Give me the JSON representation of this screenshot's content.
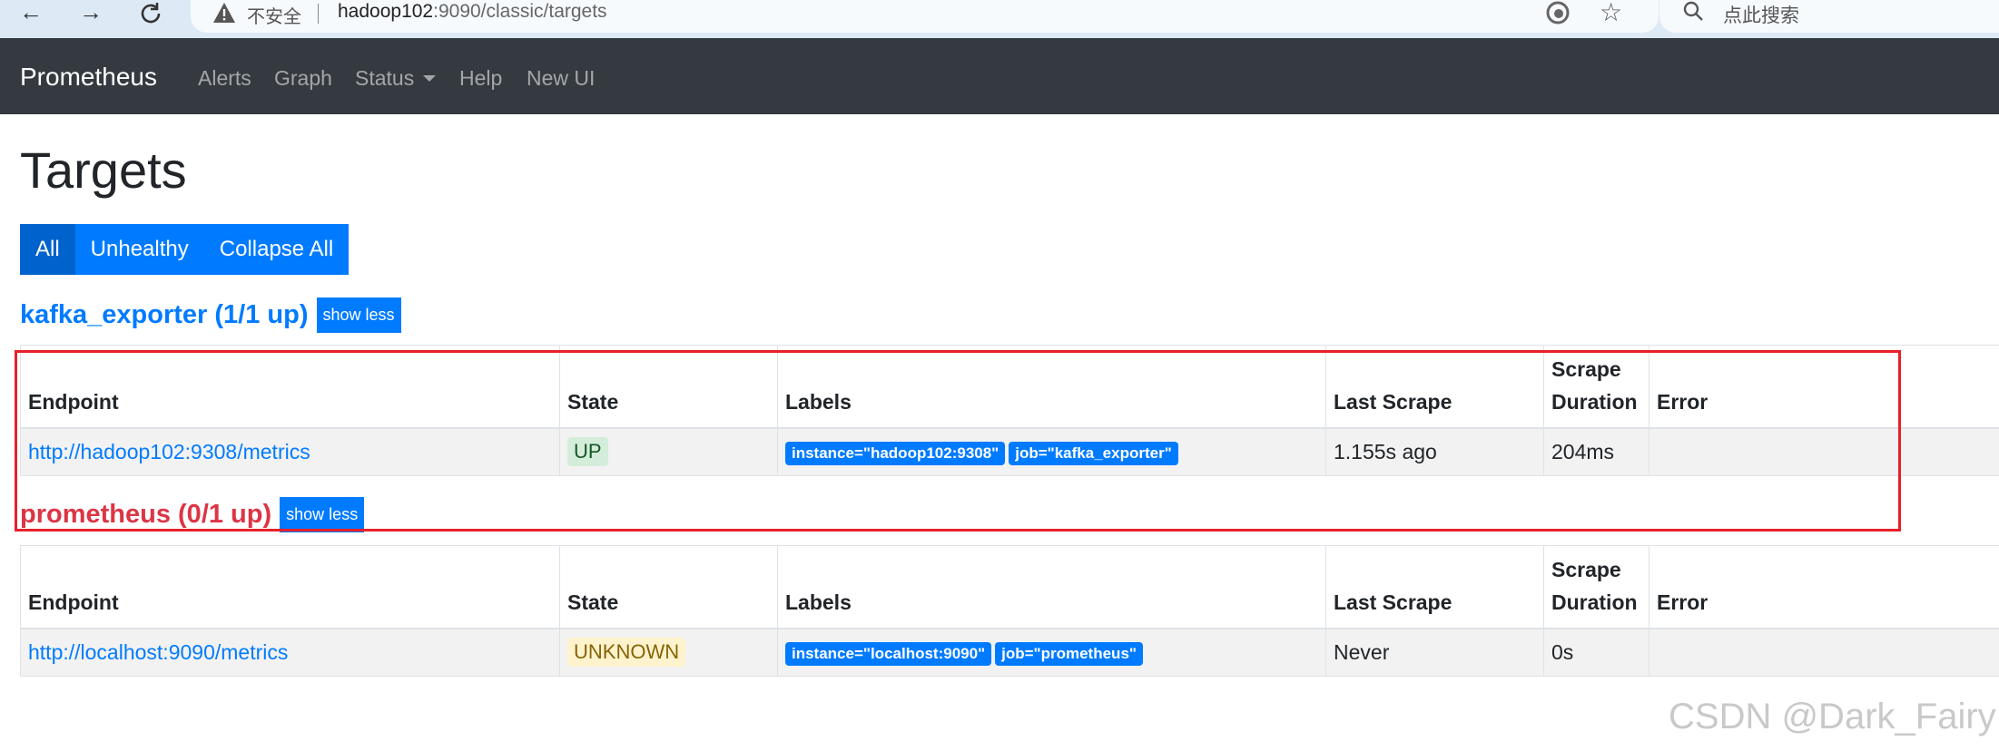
{
  "browser": {
    "insecure_label": "不安全",
    "url_host": "hadoop102",
    "url_rest": ":9090/classic/targets",
    "search_placeholder": "点此搜索"
  },
  "navbar": {
    "brand": "Prometheus",
    "links": [
      "Alerts",
      "Graph",
      "Status",
      "Help",
      "New UI"
    ]
  },
  "page": {
    "title": "Targets",
    "filters": [
      "All",
      "Unhealthy",
      "Collapse All"
    ]
  },
  "columns": [
    "Endpoint",
    "State",
    "Labels",
    "Last Scrape",
    "Scrape Duration",
    "Error"
  ],
  "jobs": [
    {
      "header": "kafka_exporter (1/1 up)",
      "toggle": "show less",
      "targets": [
        {
          "endpoint": "http://hadoop102:9308/metrics",
          "state": "UP",
          "labels": [
            "instance=\"hadoop102:9308\"",
            "job=\"kafka_exporter\""
          ],
          "last_scrape": "1.155s ago",
          "duration": "204ms",
          "error": ""
        }
      ]
    },
    {
      "header": "prometheus (0/1 up)",
      "toggle": "show less",
      "targets": [
        {
          "endpoint": "http://localhost:9090/metrics",
          "state": "UNKNOWN",
          "labels": [
            "instance=\"localhost:9090\"",
            "job=\"prometheus\""
          ],
          "last_scrape": "Never",
          "duration": "0s",
          "error": ""
        }
      ]
    }
  ],
  "watermark": "CSDN @Dark_Fairy",
  "colors": {
    "primary": "#007bff",
    "danger": "#dc3545",
    "navbar": "#343a40",
    "annotation_box": "#e8202a"
  }
}
